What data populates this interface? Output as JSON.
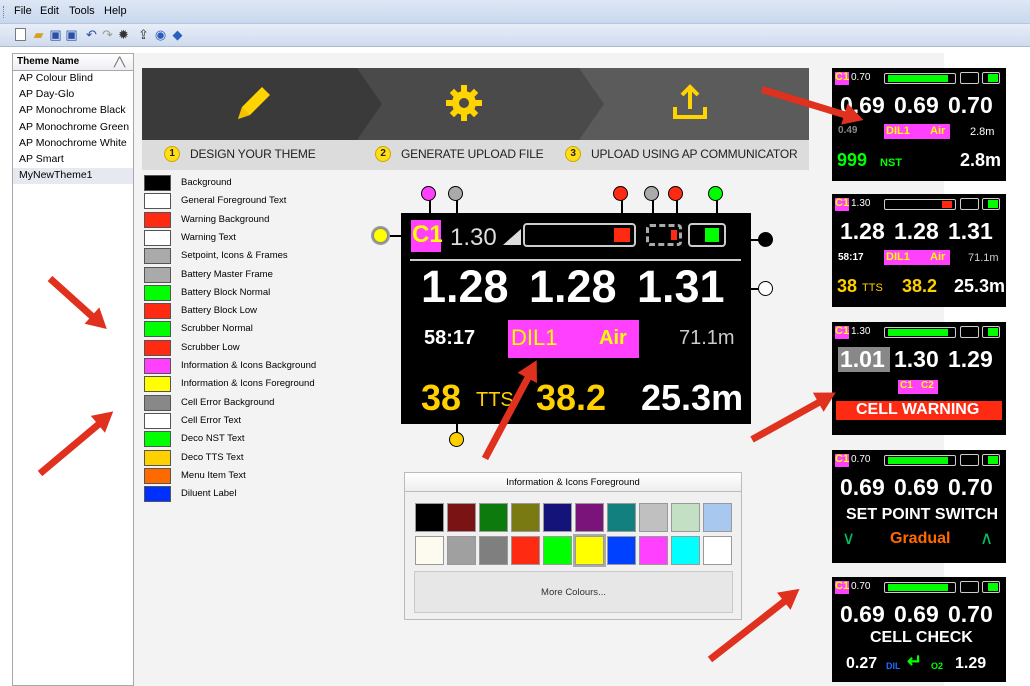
{
  "menu": [
    "File",
    "Edit",
    "Tools",
    "Help"
  ],
  "toolbar_icons": [
    "new-icon",
    "open-icon",
    "save-icon",
    "save-as-icon",
    "undo-icon",
    "redo-icon",
    "settings-icon",
    "upload-icon",
    "help-icon",
    "diamond-icon"
  ],
  "sidebar": {
    "header": "Theme Name",
    "items": [
      "AP Colour Blind",
      "AP Day-Glo",
      "AP Monochrome Black",
      "AP Monochrome Green",
      "AP Monochrome White",
      "AP Smart",
      "MyNewTheme1"
    ],
    "selected": "MyNewTheme1"
  },
  "steps": [
    {
      "num": "1",
      "label": "DESIGN YOUR THEME"
    },
    {
      "num": "2",
      "label": "GENERATE UPLOAD FILE"
    },
    {
      "num": "3",
      "label": "UPLOAD USING AP COMMUNICATOR"
    }
  ],
  "colors": [
    {
      "label": "Background",
      "color": "#000000"
    },
    {
      "label": "General Foreground Text",
      "color": "#ffffff"
    },
    {
      "label": "Warning Background",
      "color": "#ff2a12"
    },
    {
      "label": "Warning Text",
      "color": "#ffffff"
    },
    {
      "label": "Setpoint, Icons & Frames",
      "color": "#aaaaaa"
    },
    {
      "label": "Battery Master Frame",
      "color": "#aaaaaa"
    },
    {
      "label": "Battery Block Normal",
      "color": "#00ff00"
    },
    {
      "label": "Battery Block Low",
      "color": "#ff2a12"
    },
    {
      "label": "Scrubber Normal",
      "color": "#00ff00"
    },
    {
      "label": "Scrubber Low",
      "color": "#ff2a12"
    },
    {
      "label": "Information & Icons Background",
      "color": "#ff40ff"
    },
    {
      "label": "Information & Icons Foreground",
      "color": "#ffff00"
    },
    {
      "label": "Cell Error Background",
      "color": "#888888"
    },
    {
      "label": "Cell Error Text",
      "color": "#ffffff"
    },
    {
      "label": "Deco NST Text",
      "color": "#00ff00"
    },
    {
      "label": "Deco TTS Text",
      "color": "#ffd000"
    },
    {
      "label": "Menu Item Text",
      "color": "#ff6a00"
    },
    {
      "label": "Diluent Label",
      "color": "#0030ff"
    }
  ],
  "preview": {
    "cell": "C1",
    "setpoint": "1.30",
    "ppo2": [
      "1.28",
      "1.28",
      "1.31"
    ],
    "time": "58:17",
    "dil": "DIL1",
    "gas": "Air",
    "depth": "71.1m",
    "tts_val": "38",
    "tts": "TTS",
    "ceiling": "38.2",
    "dist": "25.3m"
  },
  "picker": {
    "title": "Information & Icons Foreground",
    "more": "More Colours...",
    "row1": [
      "#000000",
      "#7a1313",
      "#0d7a0d",
      "#7a7a13",
      "#13137a",
      "#7a137a",
      "#138080",
      "#c0c0c0",
      "#c4e0c4",
      "#a8c8ef"
    ],
    "row2": [
      "#fdfaf0",
      "#a0a0a0",
      "#7f7f7f",
      "#ff2a12",
      "#00ff00",
      "#ffff00",
      "#0040ff",
      "#ff40ff",
      "#00ffff",
      "#ffffff"
    ],
    "selected_index": 15
  },
  "screens": [
    {
      "cell": "C1",
      "sp": "0.70",
      "ppo2": [
        "0.69",
        "0.69",
        "0.70"
      ],
      "a": "0.49",
      "dil": "DIL1",
      "gas": "Air",
      "depth": "2.8m",
      "b": "999",
      "c": "NST",
      "d": "2.8m"
    },
    {
      "cell": "C1",
      "sp": "1.30",
      "ppo2": [
        "1.28",
        "1.28",
        "1.31"
      ],
      "time": "58:17",
      "dil": "DIL1",
      "gas": "Air",
      "depth": "71.1m",
      "b": "38",
      "c": "TTS",
      "e": "38.2",
      "d": "25.3m"
    },
    {
      "cell": "C1",
      "sp": "1.30",
      "ppo2": [
        "1.01",
        "1.30",
        "1.29"
      ],
      "flags": [
        "C1",
        "C2"
      ],
      "warn": "CELL WARNING"
    },
    {
      "cell": "C1",
      "sp": "0.70",
      "ppo2": [
        "0.69",
        "0.69",
        "0.70"
      ],
      "title": "SET POINT SWITCH",
      "mode": "Gradual"
    },
    {
      "cell": "C1",
      "sp": "0.70",
      "ppo2": [
        "0.69",
        "0.69",
        "0.70"
      ],
      "title": "CELL CHECK",
      "a": "0.27",
      "dil": "DIL",
      "o2": "O2",
      "d": "1.29"
    }
  ]
}
